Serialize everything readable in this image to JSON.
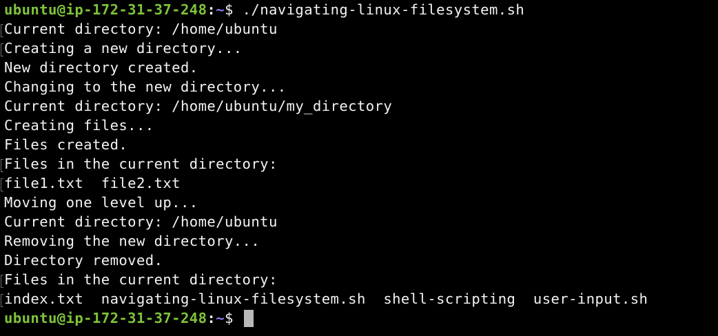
{
  "terminal": {
    "colors": {
      "background": "#000000",
      "text": "#f2f2f2",
      "prompt_user": "#7fc43a",
      "prompt_path": "#8a7bf0",
      "cursor": "#b8b8b8"
    },
    "prompt": {
      "user_host": "ubuntu@ip-172-31-37-248",
      "colon": ":",
      "path": "~",
      "symbol": "$"
    },
    "command": " ./navigating-linux-filesystem.sh",
    "output": [
      "Current directory: /home/ubuntu",
      "Creating a new directory...",
      "New directory created.",
      "Changing to the new directory...",
      "Current directory: /home/ubuntu/my_directory",
      "Creating files...",
      "Files created.",
      "Files in the current directory:",
      "file1.txt  file2.txt",
      "Moving one level up...",
      "Current directory: /home/ubuntu",
      "Removing the new directory...",
      "Directory removed.",
      "Files in the current directory:",
      "index.txt  navigating-linux-filesystem.sh  shell-scripting  user-input.sh"
    ],
    "final_prompt": {
      "user_host": "ubuntu@ip-172-31-37-248",
      "colon": ":",
      "path": "~",
      "symbol": "$ "
    }
  }
}
